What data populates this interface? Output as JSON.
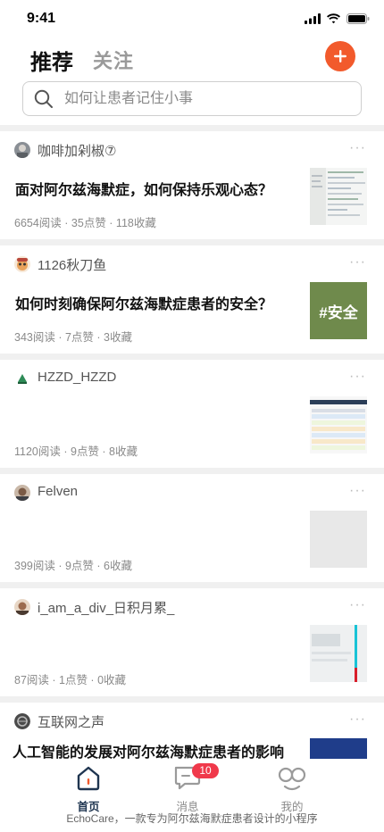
{
  "status": {
    "time": "9:41"
  },
  "header": {
    "tab_recommend": "推荐",
    "tab_follow": "关注"
  },
  "search": {
    "placeholder": "如何让患者记住小事"
  },
  "feed": [
    {
      "author": "咖啡加剁椒⑦",
      "title": "面对阿尔兹海默症，如何保持乐观心态？",
      "stats": "6654阅读 · 35点赞 · 118收藏"
    },
    {
      "author": "1126秋刀鱼",
      "title": "如何时刻确保阿尔兹海默症患者的安全？",
      "stats": "343阅读 · 7点赞 · 3收藏",
      "thumb_text": "#安全"
    },
    {
      "author": "HZZD_HZZD",
      "title": "",
      "stats": "1120阅读 · 9点赞 · 8收藏"
    },
    {
      "author": "Felven",
      "title": "",
      "stats": "399阅读 · 9点赞 · 6收藏"
    },
    {
      "author": "i_am_a_div_日积月累_",
      "title": "",
      "stats": "87阅读 · 1点赞 · 0收藏"
    },
    {
      "author": "互联网之声",
      "title": "人工智能的发展对阿尔兹海默症患者的影响",
      "stats": ""
    }
  ],
  "nav": {
    "home": "首页",
    "messages": "消息",
    "messages_badge": "10",
    "me": "我的"
  },
  "footer": "EchoCare，一款专为阿尔兹海默症患者设计的小程序",
  "colors": {
    "accent": "#f25a2c",
    "badge": "#f0394b",
    "home_icon": "#1f3550"
  }
}
